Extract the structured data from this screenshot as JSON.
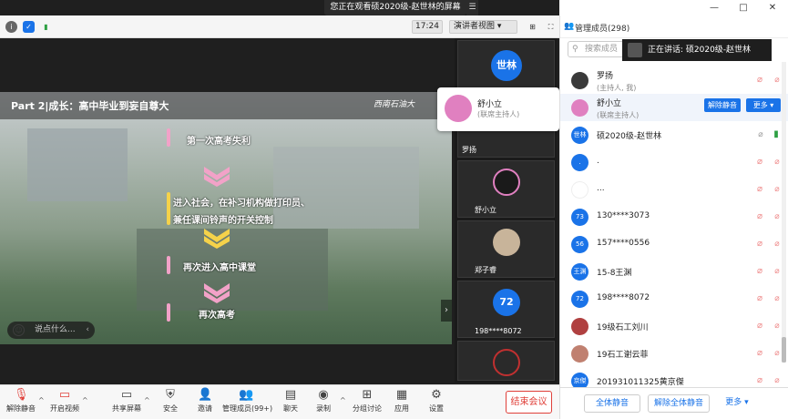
{
  "window": {
    "banner": "您正在观看硕2020级-赵世林的屏幕",
    "controls": [
      "—",
      "□",
      "✕"
    ]
  },
  "infobar": {
    "time": "17:24",
    "view_mode": "演讲者视图 ▾"
  },
  "slide": {
    "title": "Part 2|成长：高中毕业到妄自尊大",
    "logo": "西南石油大",
    "steps": [
      "第一次高考失利",
      "进入社会，在补习机构做打印员、",
      "兼任课间铃声的开关控制",
      "再次进入高中课堂",
      "再次高考"
    ],
    "chat_placeholder": "说点什么...",
    "accent_pink": "#f2a2c8",
    "accent_yellow": "#f5d24a"
  },
  "thumbs": [
    {
      "name": "世林",
      "avatar_color": "#1a73e8"
    },
    {
      "name": "罗扬"
    },
    {
      "name": "舒小立"
    },
    {
      "name": "郑子睿"
    },
    {
      "name": "198****8072",
      "avatar_text": "72",
      "avatar_color": "#1a73e8"
    },
    {
      "name": ""
    }
  ],
  "speaker_card": {
    "name": "舒小立",
    "role": "(联席主持人)"
  },
  "toolbar": {
    "items": [
      "解除静音",
      "开启视频",
      "共享屏幕",
      "安全",
      "邀请",
      "管理成员(99+)",
      "聊天",
      "录制",
      "分组讨论",
      "应用",
      "设置"
    ],
    "end_label": "结束会议"
  },
  "panel": {
    "title": "管理成员(298)",
    "search_placeholder": "搜索成员",
    "talking": "正在讲话: 硕2020级-赵世林",
    "rows": [
      {
        "name": "罗扬",
        "role": "(主持人, 我)",
        "avatar_color": "#3a3a3a",
        "avatar_text": ""
      },
      {
        "name": "舒小立",
        "role": "(联席主持人)",
        "avatar_color": "#e080c0",
        "avatar_text": ""
      },
      {
        "name": "硕2020级-赵世林",
        "role": "",
        "avatar_color": "#1a73e8",
        "avatar_text": "世林"
      },
      {
        "name": ".",
        "role": "",
        "avatar_color": "#1a73e8",
        "avatar_text": "."
      },
      {
        "name": "...",
        "role": "",
        "avatar_color": "#ffffff",
        "avatar_text": ""
      },
      {
        "name": "130****3073",
        "role": "",
        "avatar_color": "#1a73e8",
        "avatar_text": "73"
      },
      {
        "name": "157****0556",
        "role": "",
        "avatar_color": "#1a73e8",
        "avatar_text": "56"
      },
      {
        "name": "15-8王渊",
        "role": "",
        "avatar_color": "#1a73e8",
        "avatar_text": "王渊"
      },
      {
        "name": "198****8072",
        "role": "",
        "avatar_color": "#1a73e8",
        "avatar_text": "72"
      },
      {
        "name": "19级石工刘川",
        "role": "",
        "avatar_color": "#b04040",
        "avatar_text": ""
      },
      {
        "name": "19石工谢云菲",
        "role": "",
        "avatar_color": "#c08070",
        "avatar_text": ""
      },
      {
        "name": "201931011325黄京傑",
        "role": "",
        "avatar_color": "#1a73e8",
        "avatar_text": "京傑"
      }
    ],
    "unmute_label": "解除静音",
    "more_label": "更多 ▾",
    "footer": {
      "mute_all": "全体静音",
      "unmute_all": "解除全体静音",
      "more": "更多 ▾"
    }
  }
}
